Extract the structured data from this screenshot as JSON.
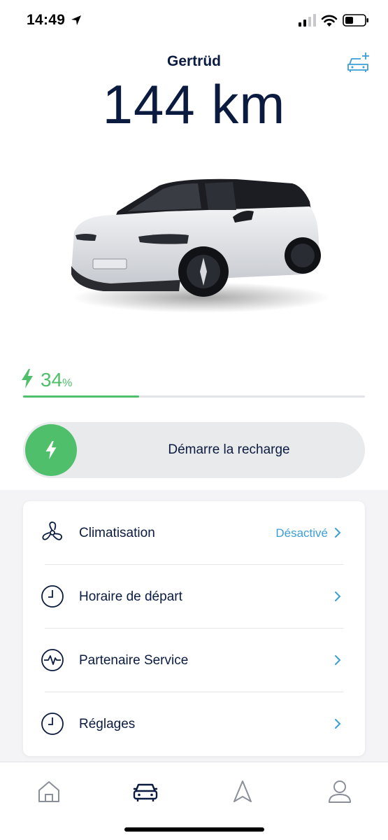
{
  "status_bar": {
    "time": "14:49"
  },
  "header": {
    "vehicle_name": "Gertrüd",
    "range": "144 km"
  },
  "battery": {
    "level_value": "34",
    "level_unit": "%",
    "fraction": 0.34,
    "color": "#4fbf6b"
  },
  "charge_action": {
    "label": "Démarre la recharge"
  },
  "controls": [
    {
      "label": "Climatisation",
      "status": "Désactivé",
      "icon": "fan-icon"
    },
    {
      "label": "Horaire de départ",
      "status": "",
      "icon": "clock-icon"
    },
    {
      "label": "Partenaire Service",
      "status": "",
      "icon": "service-pulse-icon"
    },
    {
      "label": "Réglages",
      "status": "",
      "icon": "clock-icon"
    }
  ],
  "tab_bar": [
    {
      "icon": "home-icon",
      "active": false
    },
    {
      "icon": "car-icon",
      "active": true
    },
    {
      "icon": "navigation-icon",
      "active": false
    },
    {
      "icon": "profile-icon",
      "active": false
    }
  ],
  "colors": {
    "accent_blue": "#3d9ed6",
    "navy": "#0b1b3f",
    "green": "#4fbf6b"
  }
}
